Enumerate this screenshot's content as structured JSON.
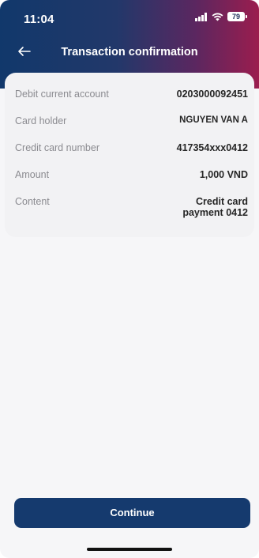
{
  "status_bar": {
    "time": "11:04",
    "battery": "79",
    "icons": [
      "cellular-signal-icon",
      "wifi-icon",
      "battery-icon"
    ]
  },
  "nav": {
    "title": "Transaction confirmation",
    "back_icon": "arrow-left-icon"
  },
  "details": {
    "debit_account_label": "Debit current account",
    "debit_account_value": "0203000092451",
    "card_holder_label": "Card holder",
    "card_holder_value": "NGUYEN VAN A",
    "card_number_label": "Credit card number",
    "card_number_value": "417354xxx0412",
    "amount_label": "Amount",
    "amount_value": "1,000 VND",
    "content_label": "Content",
    "content_value_line1": "Credit card",
    "content_value_line2": "payment 0412"
  },
  "footer": {
    "continue_label": "Continue"
  },
  "colors": {
    "header_gradient_start": "#11386b",
    "header_gradient_end": "#9b1d4e",
    "button": "#153a6e"
  }
}
